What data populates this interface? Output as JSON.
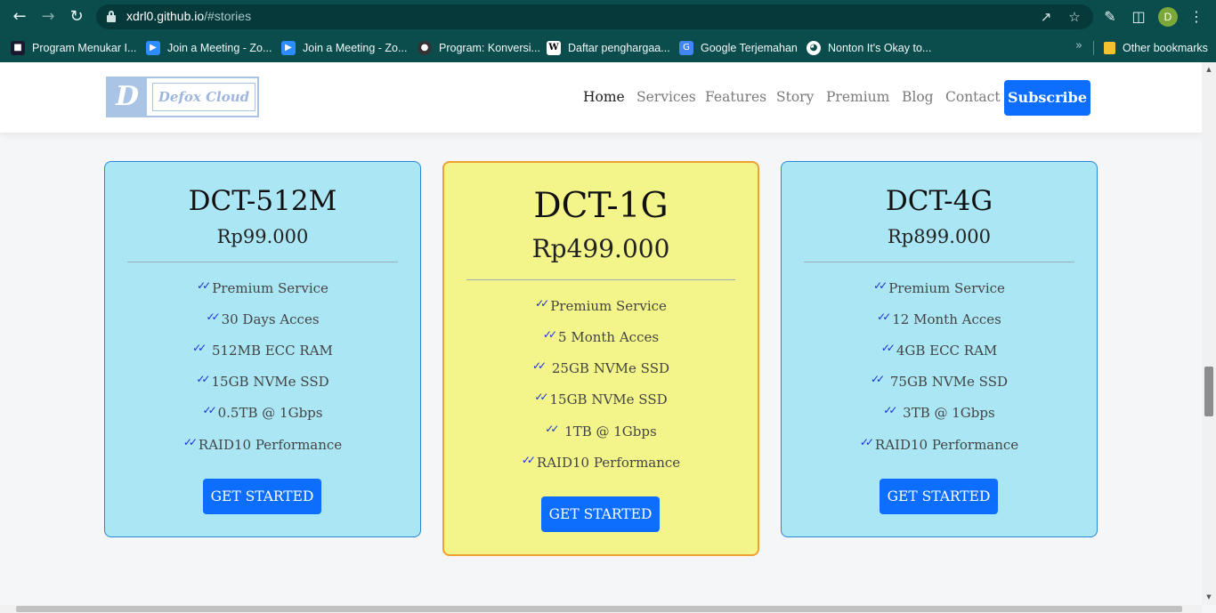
{
  "browser": {
    "url_host": "xdrl0.github.io",
    "url_path": "/#stories",
    "profile_initial": "D",
    "icons": [
      "back-icon",
      "forward-icon",
      "reload-icon",
      "lock-icon",
      "share-icon",
      "star-icon",
      "extensions-icon",
      "sidepanel-icon",
      "menu-icon"
    ]
  },
  "bookmarks": {
    "items": [
      {
        "label": "Program Menukar I...",
        "icon_color": "#1a1a2e"
      },
      {
        "label": "Join a Meeting - Zo...",
        "icon_color": "#2d8cff"
      },
      {
        "label": "Join a Meeting - Zo...",
        "icon_color": "#2d8cff"
      },
      {
        "label": "Program: Konversi...",
        "icon_color": "#333333"
      },
      {
        "label": "Daftar penghargaa...",
        "icon_color": "#ffffff"
      },
      {
        "label": "Google Terjemahan",
        "icon_color": "#4285f4"
      },
      {
        "label": "Nonton It's Okay to...",
        "icon_color": "#ffffff"
      }
    ],
    "more": "»",
    "other": "Other bookmarks"
  },
  "site": {
    "logo_letter": "D",
    "logo_text": "Defox Cloud",
    "nav": [
      "Home",
      "Services",
      "Features",
      "Story",
      "Premium",
      "Blog",
      "Contact"
    ],
    "subscribe": "Subscribe"
  },
  "plans": [
    {
      "name": "DCT-512M",
      "price": "Rp99.000",
      "features": [
        "Premium Service",
        "30 Days Acces",
        " 512MB ECC RAM",
        "15GB NVMe SSD",
        "0.5TB @ 1Gbps",
        "RAID10 Performance"
      ],
      "button": "GET STARTED",
      "color": "#abe6f4"
    },
    {
      "name": "DCT-1G",
      "price": "Rp499.000",
      "features": [
        "Premium Service",
        "5 Month Acces",
        " 25GB NVMe SSD",
        "15GB NVMe SSD",
        " 1TB @ 1Gbps",
        "RAID10 Performance"
      ],
      "button": "GET STARTED",
      "color": "#f3f58a"
    },
    {
      "name": "DCT-4G",
      "price": "Rp899.000",
      "features": [
        "Premium Service",
        "12 Month Acces",
        "4GB ECC RAM",
        " 75GB NVMe SSD",
        " 3TB @ 1Gbps",
        "RAID10 Performance"
      ],
      "button": "GET STARTED",
      "color": "#abe6f4"
    }
  ],
  "colors": {
    "accent": "#0d6efd",
    "chrome": "#0b4d4d"
  }
}
